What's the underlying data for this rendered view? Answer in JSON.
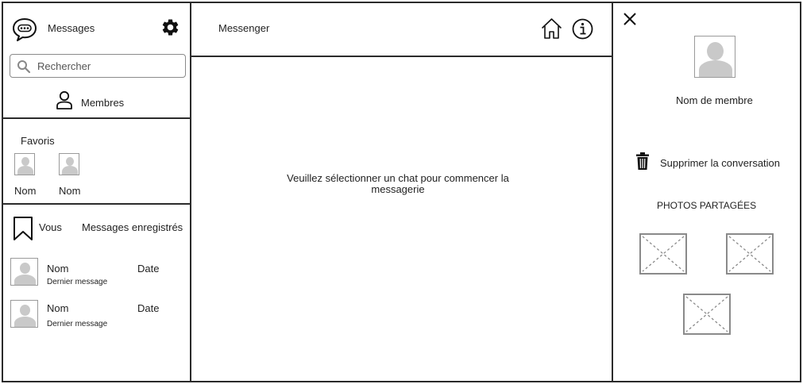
{
  "sidebar": {
    "title": "Messages",
    "search": {
      "placeholder": "Rechercher",
      "value": ""
    },
    "members_label": "Membres",
    "favorites": {
      "title": "Favoris",
      "items": [
        {
          "name": "Nom"
        },
        {
          "name": "Nom"
        }
      ]
    },
    "saved": {
      "you_label": "Vous",
      "saved_label": "Messages enregistrés"
    },
    "conversations": [
      {
        "name": "Nom",
        "date": "Date",
        "last_message": "Dernier message"
      },
      {
        "name": "Nom",
        "date": "Date",
        "last_message": "Dernier message"
      }
    ]
  },
  "main": {
    "title": "Messenger",
    "empty_state": "Veuillez sélectionner un chat pour commencer la messagerie"
  },
  "details": {
    "member_name": "Nom de membre",
    "delete_label": "Supprimer la conversation",
    "shared_photos_title": "PHOTOS PARTAGÉES"
  },
  "icons": {
    "chat": "chat-bubble-icon",
    "settings": "gear-icon",
    "search": "search-icon",
    "members": "user-icon",
    "home": "home-icon",
    "info": "info-icon",
    "close": "close-icon",
    "delete": "trash-icon",
    "saved": "bookmark-icon"
  }
}
